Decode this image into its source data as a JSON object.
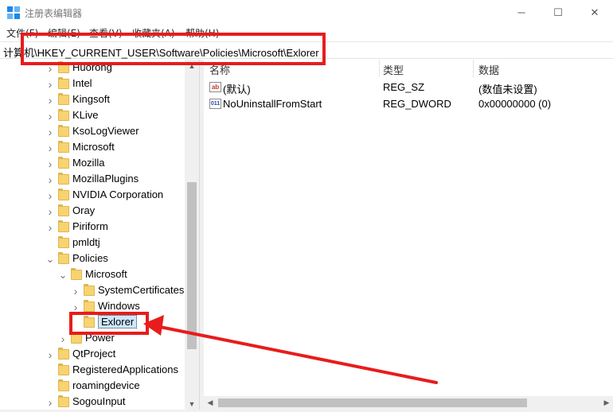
{
  "window": {
    "title": "注册表编辑器",
    "minimize_glyph": "─",
    "maximize_glyph": "☐",
    "close_glyph": "✕"
  },
  "menu": [
    {
      "label": "文件(F)"
    },
    {
      "label": "编辑(E)"
    },
    {
      "label": "查看(V)"
    },
    {
      "label": "收藏夹(A)"
    },
    {
      "label": "帮助(H)"
    }
  ],
  "address": {
    "path": "计算机\\HKEY_CURRENT_USER\\Software\\Policies\\Microsoft\\Exlorer"
  },
  "tree": [
    {
      "label": "Huorong",
      "level": 1,
      "expander": "collapsed"
    },
    {
      "label": "Intel",
      "level": 1,
      "expander": "collapsed"
    },
    {
      "label": "Kingsoft",
      "level": 1,
      "expander": "collapsed"
    },
    {
      "label": "KLive",
      "level": 1,
      "expander": "collapsed"
    },
    {
      "label": "KsoLogViewer",
      "level": 1,
      "expander": "collapsed"
    },
    {
      "label": "Microsoft",
      "level": 1,
      "expander": "collapsed"
    },
    {
      "label": "Mozilla",
      "level": 1,
      "expander": "collapsed"
    },
    {
      "label": "MozillaPlugins",
      "level": 1,
      "expander": "collapsed"
    },
    {
      "label": "NVIDIA Corporation",
      "level": 1,
      "expander": "collapsed"
    },
    {
      "label": "Oray",
      "level": 1,
      "expander": "collapsed"
    },
    {
      "label": "Piriform",
      "level": 1,
      "expander": "collapsed"
    },
    {
      "label": "pmldtj",
      "level": 1,
      "expander": "none"
    },
    {
      "label": "Policies",
      "level": 1,
      "expander": "expanded"
    },
    {
      "label": "Microsoft",
      "level": 2,
      "expander": "expanded"
    },
    {
      "label": "SystemCertificates",
      "level": 3,
      "expander": "collapsed"
    },
    {
      "label": "Windows",
      "level": 3,
      "expander": "collapsed"
    },
    {
      "label": "Exlorer",
      "level": 3,
      "expander": "none",
      "selected": true
    },
    {
      "label": "Power",
      "level": 2,
      "expander": "collapsed"
    },
    {
      "label": "QtProject",
      "level": 1,
      "expander": "collapsed"
    },
    {
      "label": "RegisteredApplications",
      "level": 1,
      "expander": "none"
    },
    {
      "label": "roamingdevice",
      "level": 1,
      "expander": "none"
    },
    {
      "label": "SogouInput",
      "level": 1,
      "expander": "collapsed"
    }
  ],
  "columns": {
    "name": "名称",
    "type": "类型",
    "data": "数据"
  },
  "values": [
    {
      "icon": "string-value-icon",
      "icon_text": "ab",
      "name": "(默认)",
      "type": "REG_SZ",
      "data": "(数值未设置)"
    },
    {
      "icon": "dword-value-icon",
      "icon_text": "011",
      "name": "NoUninstallFromStart",
      "type": "REG_DWORD",
      "data": "0x00000000 (0)"
    }
  ],
  "colors": {
    "annotation_red": "#e81c1c",
    "folder_yellow": "#f7d470",
    "selection_blue": "#cce8ff"
  }
}
